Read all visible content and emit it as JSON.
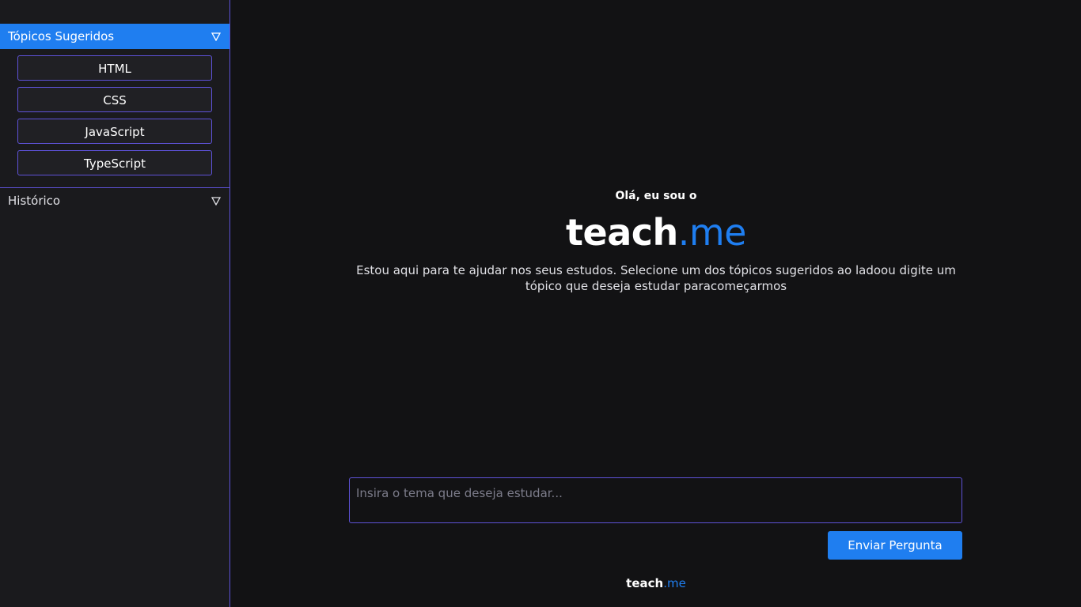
{
  "sidebar": {
    "topics_section": {
      "title": "Tópicos Sugeridos",
      "items": [
        {
          "label": "HTML"
        },
        {
          "label": "CSS"
        },
        {
          "label": "JavaScript"
        },
        {
          "label": "TypeScript"
        }
      ]
    },
    "history_section": {
      "title": "Histórico"
    }
  },
  "main": {
    "greeting": "Olá, eu sou o",
    "logo": {
      "name": "teach",
      "suffix": ".me"
    },
    "intro": "Estou aqui para te ajudar nos seus estudos. Selecione um dos tópicos sugeridos ao ladoou digite um tópico que deseja estudar paracomeçarmos",
    "input": {
      "placeholder": "Insira o tema que deseja estudar...",
      "value": ""
    },
    "send_label": "Enviar Pergunta",
    "footer_logo": {
      "name": "teach",
      "suffix": ".me"
    }
  },
  "colors": {
    "accent": "#1f7ef0",
    "border": "#5e52d8",
    "background": "#121214",
    "sidebar": "#1a1a1d"
  }
}
